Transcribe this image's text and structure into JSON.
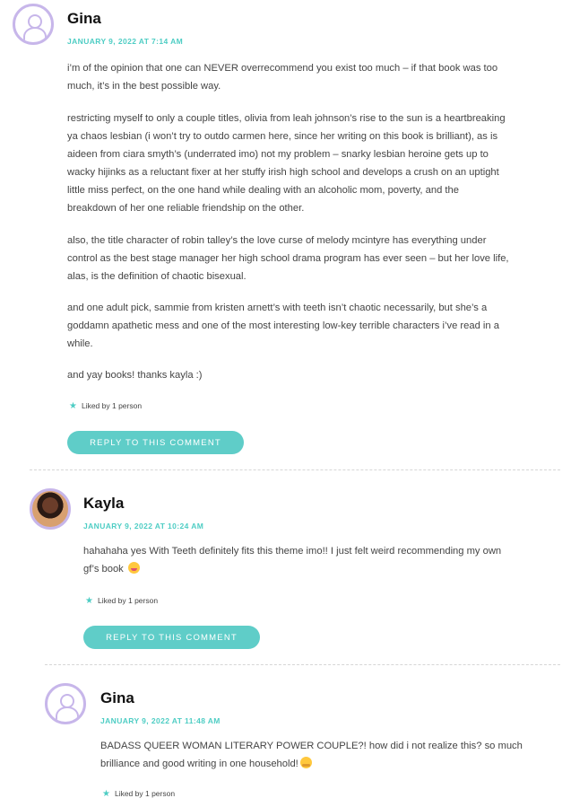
{
  "comments": [
    {
      "author": "Gina",
      "date": "JANUARY 9, 2022 AT 7:14 AM",
      "paragraphs": [
        "i’m of the opinion that one can NEVER overrecommend you exist too much – if that book was too",
        "much, it’s in the best possible way.",
        "restricting myself to only a couple titles, olivia from leah johnson’s rise to the sun is a heartbreaking",
        "ya chaos lesbian (i won’t try to outdo carmen here, since her writing on this book is brilliant), as is",
        "aideen from ciara smyth’s (underrated imo) not my problem – snarky lesbian heroine gets up to",
        "wacky hijinks as a reluctant fixer at her stuffy irish high school and develops a crush on an uptight",
        "little miss perfect, on the one hand while dealing with an alcoholic mom, poverty, and the",
        "breakdown of her one reliable friendship on the other.",
        "also, the title character of robin talley’s the love curse of melody mcintyre has everything under",
        "control as the best stage manager her high school drama program has ever seen – but her love life,",
        "alas, is the definition of chaotic bisexual.",
        "and one adult pick, sammie from kristen arnett’s with teeth isn’t chaotic necessarily, but she’s a",
        "goddamn apathetic mess and one of the most interesting low-key terrible characters i’ve read in a",
        "while.",
        "and yay books! thanks kayla :)"
      ],
      "liked": "Liked by 1 person",
      "reply_label": "REPLY TO THIS COMMENT"
    },
    {
      "author": "Kayla",
      "date": "JANUARY 9, 2022 AT 10:24 AM",
      "paragraphs": [
        "hahahaha yes With Teeth definitely fits this theme imo!! I just felt weird recommending my own",
        "gf’s book"
      ],
      "liked": "Liked by 1 person",
      "reply_label": "REPLY TO THIS COMMENT"
    },
    {
      "author": "Gina",
      "date": "JANUARY 9, 2022 AT 11:48 AM",
      "paragraphs": [
        "BADASS QUEER WOMAN LITERARY POWER COUPLE?! how did i not realize this? so much",
        "brilliance and good writing in one household!"
      ],
      "liked": "Liked by 1 person"
    }
  ],
  "colors": {
    "accent": "#4ecdc4",
    "button": "#5fcdc8",
    "avatar_border": "#c7b6ea"
  },
  "icons": {
    "like": "star-icon",
    "default_avatar": "default-avatar-icon",
    "emoji_1": "winking-face-with-tongue-emoji",
    "emoji_2": "hugging-face-emoji"
  }
}
